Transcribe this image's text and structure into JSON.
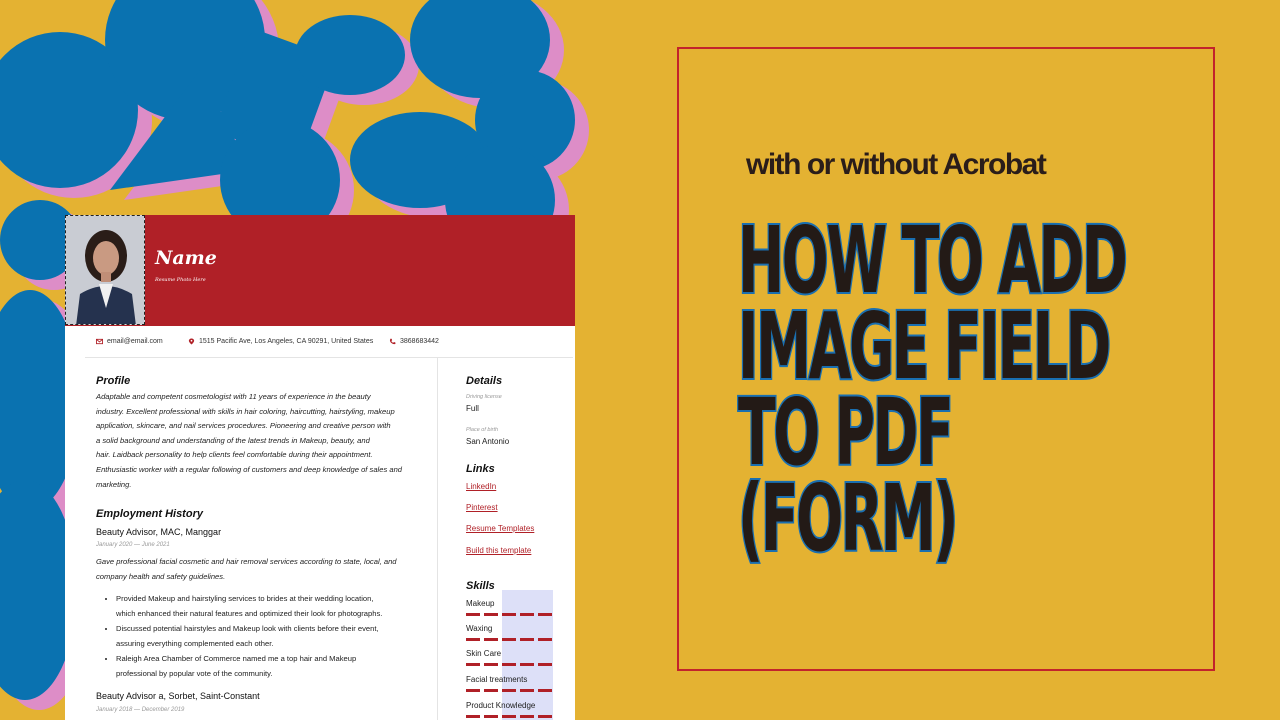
{
  "colors": {
    "background": "#e4b232",
    "blue": "#0a72b0",
    "pink": "#dd8dc7",
    "resume_red": "#b02027",
    "frame_red": "#c2232c",
    "headline_dark": "#231a16",
    "headline_outline": "#1a6fb0"
  },
  "thumbnail": {
    "subtitle": "with or without Acrobat",
    "headline_lines": [
      "HOW TO ADD",
      "IMAGE FIELD",
      "TO PDF",
      "(FORM)"
    ]
  },
  "resume": {
    "name": "Name",
    "name_subtitle": "Resume Photo Here",
    "contact": {
      "email": "email@email.com",
      "address": "1515 Pacific Ave, Los Angeles, CA 90291, United States",
      "phone": "3868683442"
    },
    "profile": {
      "title": "Profile",
      "lines": [
        "Adaptable and competent cosmetologist with 11 years of experience in the beauty",
        "industry. Excellent professional with skills in hair coloring, haircutting, hairstyling, makeup",
        "application, skincare, and nail services procedures. Pioneering and creative person with",
        "a solid background and understanding of the latest trends in Makeup, beauty, and",
        "hair. Laidback personality to help clients feel comfortable during their appointment.",
        "Enthusiastic worker with a regular following of customers and deep knowledge of sales and",
        "marketing."
      ]
    },
    "employment": {
      "title": "Employment History",
      "jobs": [
        {
          "title": "Beauty Advisor, MAC, Manggar",
          "dates": "January 2020 — June 2021",
          "description_lines": [
            "Gave professional facial cosmetic and hair removal services according to state, local, and",
            "company health and safety guidelines."
          ],
          "bullets": [
            {
              "lines": [
                "Provided Makeup and hairstyling services to brides at their wedding location,",
                "which enhanced their natural features and optimized their look for photographs."
              ]
            },
            {
              "lines": [
                "Discussed potential hairstyles and Makeup look with clients before their event,",
                "assuring everything complemented each other."
              ]
            },
            {
              "lines": [
                "Raleigh Area Chamber of Commerce named me a top hair and Makeup",
                "professional by popular vote of the community."
              ]
            }
          ]
        },
        {
          "title": "Beauty Advisor a, Sorbet, Saint-Constant",
          "dates": "January 2018 — December 2019"
        }
      ]
    },
    "details": {
      "title": "Details",
      "items": [
        {
          "label": "Driving license",
          "value": "Full"
        },
        {
          "label": "Place of birth",
          "value": "San Antonio"
        }
      ]
    },
    "links": {
      "title": "Links",
      "items": [
        "LinkedIn",
        "Pinterest",
        "Resume Templates",
        "Build this template"
      ]
    },
    "skills": {
      "title": "Skills",
      "items": [
        "Makeup",
        "Waxing",
        "Skin Care",
        "Facial treatments",
        "Product Knowledge"
      ]
    }
  }
}
